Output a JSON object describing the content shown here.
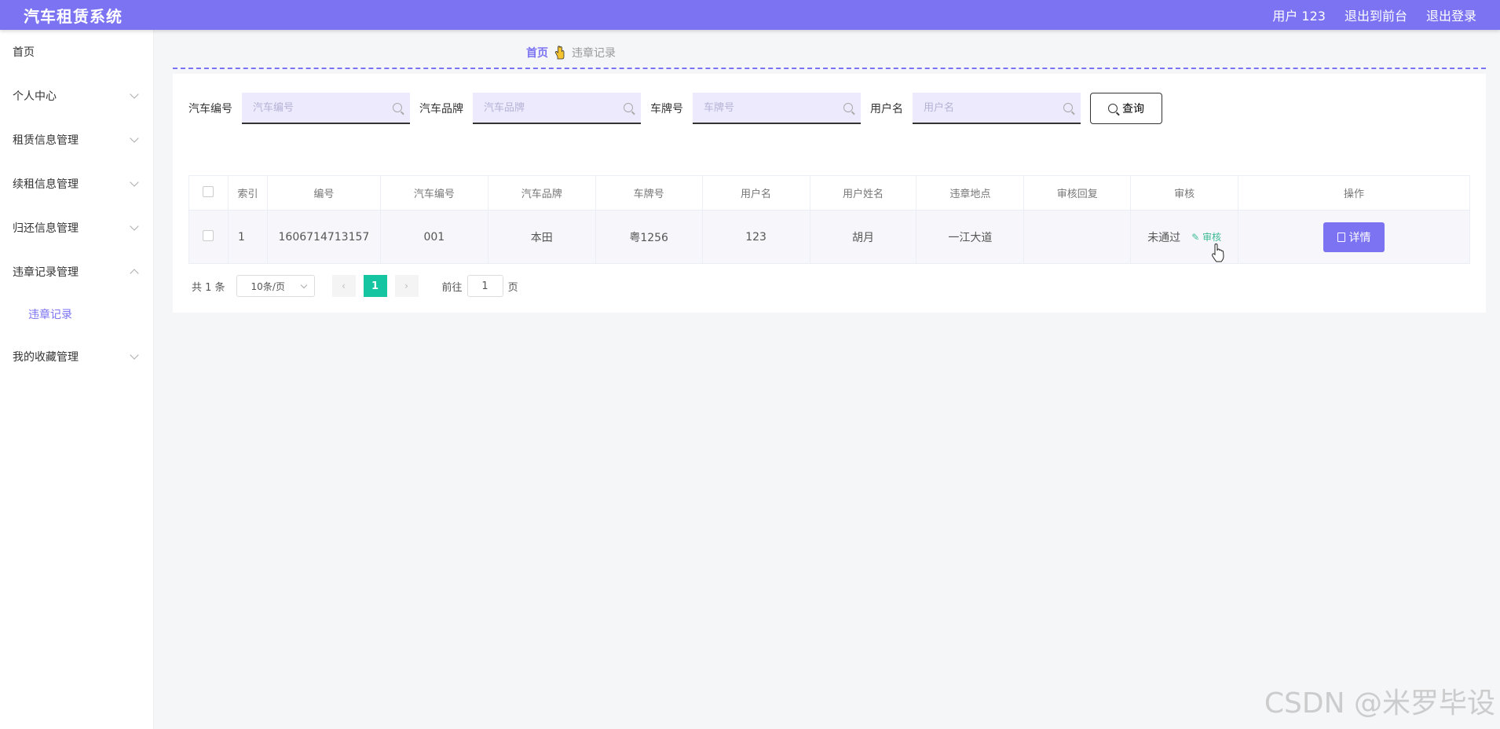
{
  "header": {
    "app_title": "汽车租赁系统",
    "user": "用户 123",
    "to_front": "退出到前台",
    "logout": "退出登录"
  },
  "sidebar": {
    "items": [
      {
        "label": "首页"
      },
      {
        "label": "个人中心"
      },
      {
        "label": "租赁信息管理"
      },
      {
        "label": "续租信息管理"
      },
      {
        "label": "归还信息管理"
      },
      {
        "label": "违章记录管理"
      },
      {
        "label": "违章记录"
      },
      {
        "label": "我的收藏管理"
      }
    ]
  },
  "breadcrumb": {
    "home": "首页",
    "current": "违章记录"
  },
  "search": {
    "fields": [
      {
        "label": "汽车编号",
        "placeholder": "汽车编号"
      },
      {
        "label": "汽车品牌",
        "placeholder": "汽车品牌"
      },
      {
        "label": "车牌号",
        "placeholder": "车牌号"
      },
      {
        "label": "用户名",
        "placeholder": "用户名"
      }
    ],
    "button": "查询"
  },
  "table": {
    "headers": [
      "索引",
      "编号",
      "汽车编号",
      "汽车品牌",
      "车牌号",
      "用户名",
      "用户姓名",
      "违章地点",
      "审核回复",
      "审核",
      "操作"
    ],
    "rows": [
      {
        "index": "1",
        "number": "1606714713157",
        "car_number": "001",
        "brand": "本田",
        "plate": "粤1256",
        "username": "123",
        "realname": "胡月",
        "location": "一江大道",
        "reply": "",
        "status": "未通过",
        "audit_link": "审核",
        "action": "详情"
      }
    ]
  },
  "pager": {
    "total": "共 1 条",
    "page_size": "10条/页",
    "current_page": "1",
    "goto_label": "前往",
    "goto_value": "1",
    "page_suffix": "页"
  },
  "watermark": "CSDN @米罗毕设",
  "colors": {
    "primary": "#7b73f2",
    "success": "#15c4a0",
    "link": "#3cba92"
  }
}
